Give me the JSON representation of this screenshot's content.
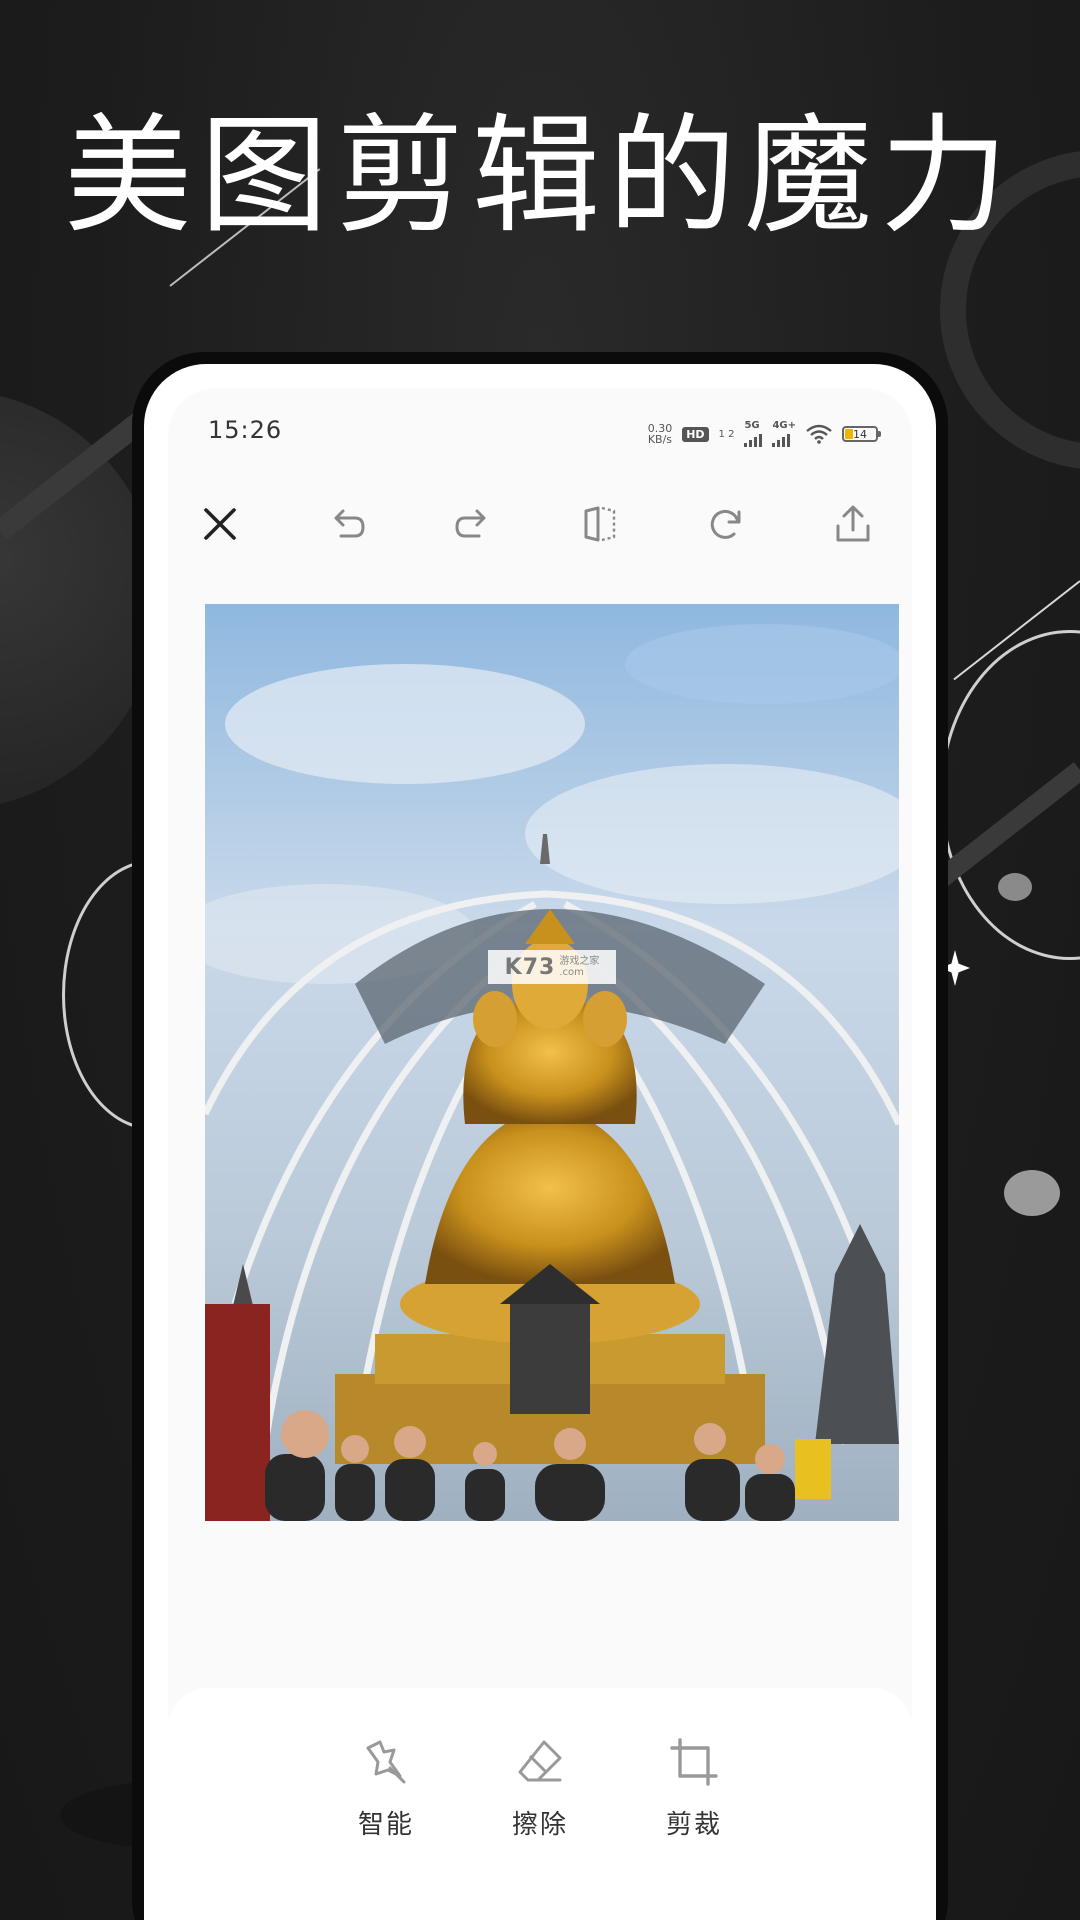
{
  "headline": "美图剪辑的魔力",
  "status_bar": {
    "time": "15:26",
    "net_speed_value": "0.30",
    "net_speed_unit": "KB/s",
    "hd_badge": "HD",
    "hd_sub": "1 2",
    "signal_1": "5G",
    "signal_2": "4G+",
    "battery": "14"
  },
  "toolbar": {
    "icons": [
      "close-icon",
      "undo-icon",
      "redo-icon",
      "flip-icon",
      "rotate-icon",
      "share-icon"
    ]
  },
  "photo": {
    "watermark_main": "K73",
    "watermark_sub_1": "游戏之家",
    "watermark_sub_2": ".com"
  },
  "actions": [
    {
      "label": "智能",
      "icon": "smart-wand-icon"
    },
    {
      "label": "擦除",
      "icon": "eraser-icon"
    },
    {
      "label": "剪裁",
      "icon": "crop-icon"
    }
  ],
  "colors": {
    "background": "#1f1f1f",
    "phone_frame": "#0b0b0b",
    "screen": "#fafafa",
    "icon_dark": "#222222",
    "icon_light": "#888888"
  }
}
